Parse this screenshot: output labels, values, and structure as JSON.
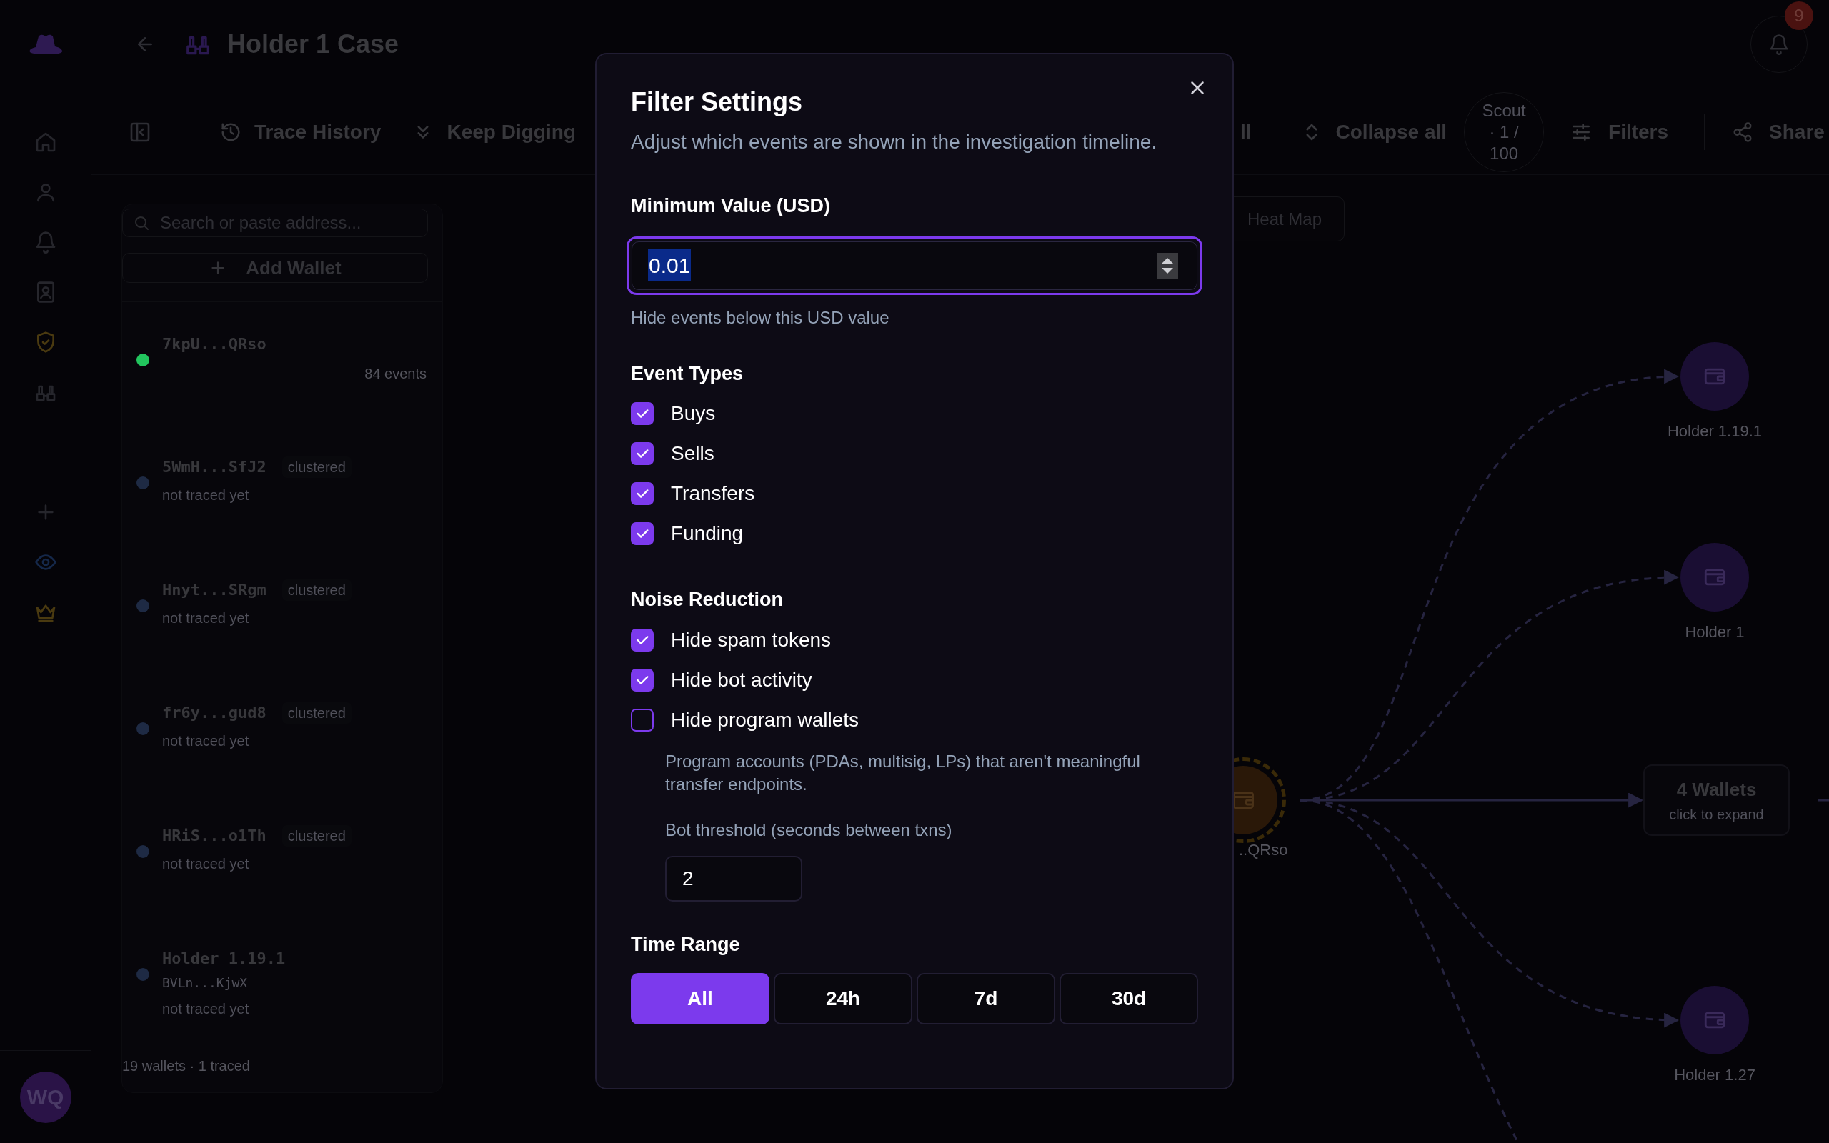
{
  "rail": {
    "avatar": "WQ"
  },
  "header": {
    "title": "Holder 1 Case",
    "notifications": "9"
  },
  "toolbar": {
    "items": [
      {
        "kind": "history",
        "label": "Trace History"
      },
      {
        "kind": "dig",
        "label": "Keep Digging"
      },
      {
        "kind": "partial",
        "label": "ll"
      },
      {
        "kind": "collapse",
        "label": "Collapse all"
      }
    ],
    "scout": "Scout · 1 / 100",
    "filters": "Filters",
    "share": "Share"
  },
  "sidebar": {
    "search": {
      "placeholder": "Search or paste address..."
    },
    "add_button": "Add Wallet",
    "wallets": [
      {
        "title": "7kpU...QRso",
        "events": "84 events",
        "color": "#22c55e"
      },
      {
        "title": "5WmH...SfJ2",
        "tag": "clustered",
        "status": "not traced yet",
        "color": "#1e2a44"
      },
      {
        "title": "Hnyt...SRgm",
        "tag": "clustered",
        "status": "not traced yet",
        "color": "#1e2a44"
      },
      {
        "title": "fr6y...gud8",
        "tag": "clustered",
        "status": "not traced yet",
        "color": "#1e2a44"
      },
      {
        "title": "HRiS...o1Th",
        "tag": "clustered",
        "status": "not traced yet",
        "color": "#1e2a44"
      },
      {
        "title": "Holder 1.19.1",
        "address": "BVLn...KjwX",
        "status": "not traced yet",
        "color": "#1e2a44"
      }
    ],
    "footer": "19 wallets · 1 traced"
  },
  "view_toggle": {
    "label": "Heat Map"
  },
  "graph": {
    "root": {
      "label": "..QRso"
    },
    "nodes": [
      {
        "label": "Holder 1.19.1"
      },
      {
        "label": "Holder 1"
      },
      {
        "label": "Holder 1.27"
      }
    ],
    "group": {
      "title": "4 Wallets",
      "hint": "click to expand"
    }
  },
  "dialog": {
    "title": "Filter Settings",
    "subtitle": "Adjust which events are shown in the investigation timeline.",
    "min_value": {
      "label": "Minimum Value (USD)",
      "value": "0.01",
      "hint": "Hide events below this USD value"
    },
    "event_types": {
      "title": "Event Types",
      "options": [
        {
          "label": "Buys",
          "checked": true
        },
        {
          "label": "Sells",
          "checked": true
        },
        {
          "label": "Transfers",
          "checked": true
        },
        {
          "label": "Funding",
          "checked": true
        }
      ]
    },
    "noise": {
      "title": "Noise Reduction",
      "options": [
        {
          "label": "Hide spam tokens",
          "checked": true
        },
        {
          "label": "Hide bot activity",
          "checked": true
        },
        {
          "label": "Hide program wallets",
          "checked": false
        }
      ],
      "description": "Program accounts (PDAs, multisig, LPs) that aren't meaningful transfer endpoints.",
      "threshold_label": "Bot threshold (seconds between txns)",
      "threshold_value": "2"
    },
    "time_range": {
      "title": "Time Range",
      "options": [
        {
          "label": "All",
          "selected": true
        },
        {
          "label": "24h",
          "selected": false
        },
        {
          "label": "7d",
          "selected": false
        },
        {
          "label": "30d",
          "selected": false
        }
      ]
    }
  }
}
